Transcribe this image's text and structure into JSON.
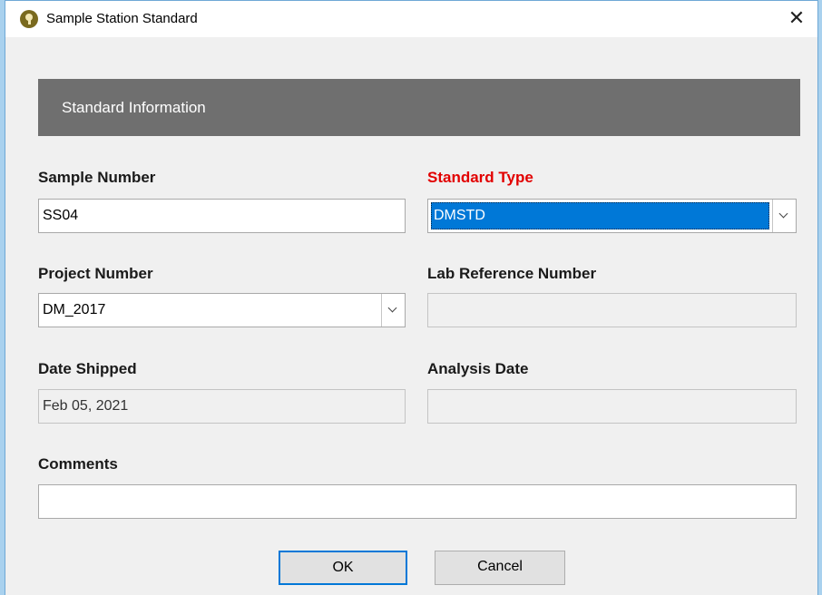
{
  "window": {
    "title": "Sample Station Standard",
    "close_glyph": "✕"
  },
  "section": {
    "header": "Standard Information"
  },
  "fields": {
    "sample_number": {
      "label": "Sample Number",
      "value": "SS04"
    },
    "standard_type": {
      "label": "Standard Type",
      "value": "DMSTD"
    },
    "project_number": {
      "label": "Project Number",
      "value": "DM_2017"
    },
    "lab_reference_number": {
      "label": "Lab Reference Number",
      "value": ""
    },
    "date_shipped": {
      "label": "Date Shipped",
      "value": "Feb 05, 2021"
    },
    "analysis_date": {
      "label": "Analysis Date",
      "value": ""
    },
    "comments": {
      "label": "Comments",
      "value": ""
    }
  },
  "buttons": {
    "ok": "OK",
    "cancel": "Cancel"
  },
  "colors": {
    "required_label": "#e20000",
    "selection": "#0078d7",
    "section_header_bg": "#6f6f6f"
  },
  "icons": {
    "app": "keyhole-icon",
    "close": "close-icon",
    "dropdown": "chevron-down-icon"
  }
}
